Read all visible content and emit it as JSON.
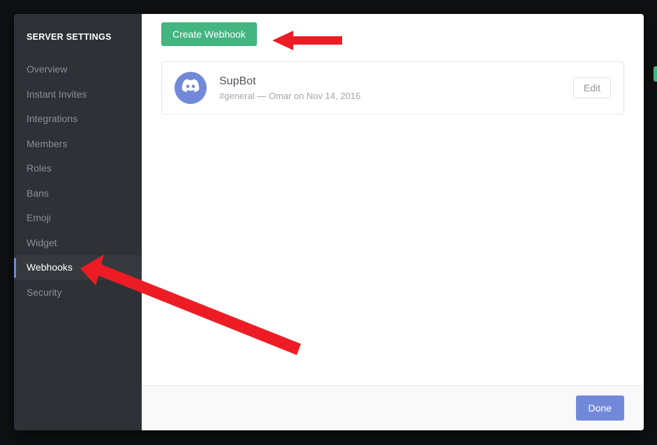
{
  "sidebar": {
    "header": "SERVER SETTINGS",
    "items": [
      {
        "label": "Overview",
        "active": false
      },
      {
        "label": "Instant Invites",
        "active": false
      },
      {
        "label": "Integrations",
        "active": false
      },
      {
        "label": "Members",
        "active": false
      },
      {
        "label": "Roles",
        "active": false
      },
      {
        "label": "Bans",
        "active": false
      },
      {
        "label": "Emoji",
        "active": false
      },
      {
        "label": "Widget",
        "active": false
      },
      {
        "label": "Webhooks",
        "active": true
      },
      {
        "label": "Security",
        "active": false
      }
    ]
  },
  "toolbar": {
    "create_webhook_label": "Create Webhook"
  },
  "webhooks": [
    {
      "name": "SupBot",
      "channel": "#general",
      "detail_separator": "—",
      "detail": "Omar on Nov 14, 2016",
      "edit_label": "Edit"
    }
  ],
  "footer": {
    "done_label": "Done"
  },
  "colors": {
    "accent": "#7289da",
    "success": "#43b581",
    "sidebar_bg": "#2e3136",
    "arrow": "#ed1c24"
  }
}
